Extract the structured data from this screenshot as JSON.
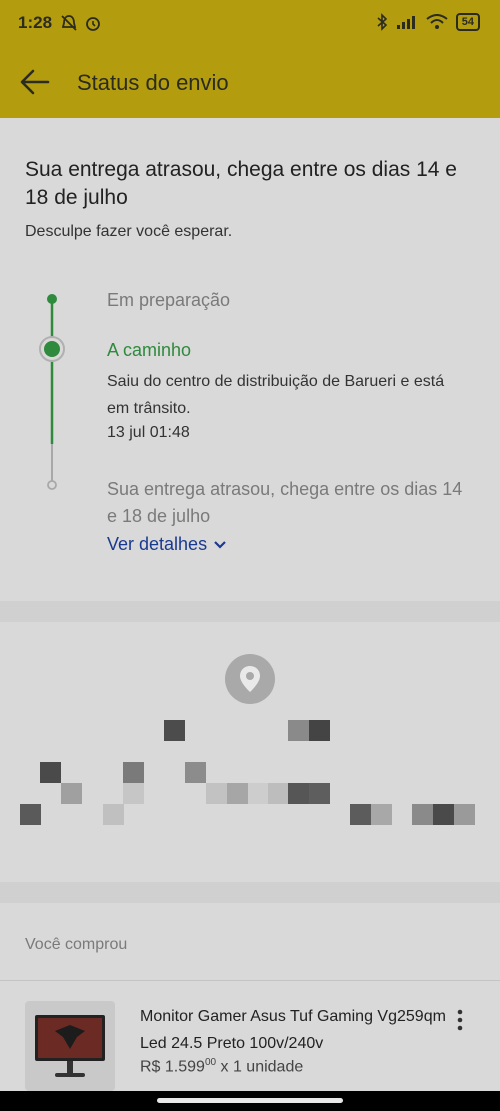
{
  "status_bar": {
    "time": "1:28",
    "battery": "54"
  },
  "app_bar": {
    "title": "Status do envio",
    "back_icon": "arrow-left-icon"
  },
  "delivery": {
    "headline": "Sua entrega atrasou, chega entre os dias 14 e 18 de julho",
    "apology": "Desculpe fazer você esperar.",
    "steps": [
      {
        "label": "Em preparação",
        "state": "done"
      },
      {
        "label": "A caminho",
        "state": "current",
        "description": "Saiu do centro de distribuição de Barueri e está em trânsito.",
        "time": "13 jul 01:48"
      },
      {
        "label": "Sua entrega atrasou, chega entre os dias 14 e 18 de julho",
        "state": "pending"
      }
    ],
    "details_link": "Ver detalhes"
  },
  "purchase": {
    "label": "Você comprou",
    "product_title": "Monitor Gamer Asus Tuf Gaming Vg259qm Led 24.5 Preto 100v/240v",
    "price_prefix": "R$ 1.599",
    "price_cents": "00",
    "quantity": "x 1 unidade"
  },
  "colors": {
    "accent": "#b39d0e",
    "success": "#2e8a3c",
    "link": "#1a3a8f"
  }
}
